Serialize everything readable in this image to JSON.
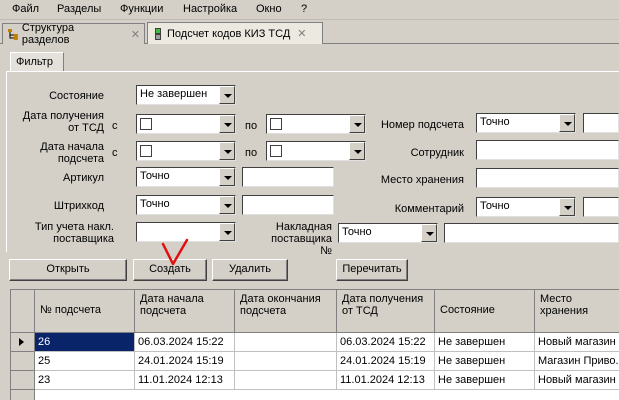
{
  "menu": [
    "Файл",
    "Разделы",
    "Функции",
    "Настройка",
    "Окно",
    "?"
  ],
  "tabs": [
    {
      "label": "Структура разделов",
      "close": "✕"
    },
    {
      "label": "Подсчет кодов КИЗ ТСД",
      "close": "✕"
    }
  ],
  "filter": {
    "tab_label": "Фильтр",
    "state_label": "Состояние",
    "state_value": "Не завершен",
    "date_recv_label": "Дата получения от ТСД",
    "date_start_label": "Дата начала подсчета",
    "from": "с",
    "to": "по",
    "article_label": "Артикул",
    "barcode_label": "Штрихкод",
    "acc_type_label": "Тип учета накл. поставщика",
    "count_no_label": "Номер подсчета",
    "employee_label": "Сотрудник",
    "storage_label": "Место хранения",
    "comment_label": "Комментарий",
    "invoice_label": "Накладная поставщика №",
    "exact": "Точно"
  },
  "buttons": {
    "open": "Открыть",
    "create": "Создать",
    "delete": "Удалить",
    "reread": "Перечитать"
  },
  "grid": {
    "columns": [
      "№ подсчета",
      "Дата начала подсчета",
      "Дата окончания подсчета",
      "Дата получения от ТСД",
      "Состояние",
      "Место хранения"
    ],
    "rows": [
      [
        "26",
        "06.03.2024 15:22",
        "",
        "06.03.2024 15:22",
        "Не завершен",
        "Новый магазин"
      ],
      [
        "25",
        "24.01.2024 15:19",
        "",
        "24.01.2024 15:19",
        "Не завершен",
        "Магазин Приво..."
      ],
      [
        "23",
        "11.01.2024 12:13",
        "",
        "11.01.2024 12:13",
        "Не завершен",
        "Новый магазин"
      ]
    ]
  }
}
